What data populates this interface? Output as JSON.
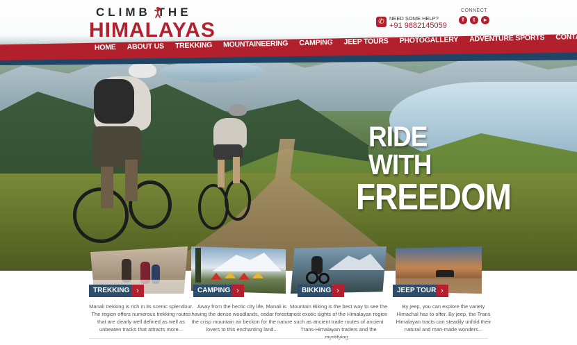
{
  "logo": {
    "line1": "CLIMB  THE",
    "line2": "HIMALAYAS"
  },
  "contact": {
    "help_label": "NEED SOME HELP?",
    "phone": "+91 9882145059",
    "connect_label": "CONNECT",
    "social": [
      {
        "icon": "facebook-icon",
        "glyph": "f"
      },
      {
        "icon": "twitter-icon",
        "glyph": "t"
      },
      {
        "icon": "youtube-icon",
        "glyph": "▸"
      }
    ]
  },
  "nav": {
    "items": [
      "HOME",
      "ABOUT US",
      "TREKKING",
      "MOUNTAINEERING",
      "CAMPING",
      "JEEP TOURS",
      "PHOTOGALLERY",
      "ADVENTURE SPORTS",
      "CONTACT"
    ]
  },
  "hero": {
    "line1": "RIDE WITH",
    "line2": "FREEDOM"
  },
  "cards": [
    {
      "tag": "TREKKING",
      "text": "Manali trekking is rich in its scenic splendour. The region offers numerous trekking routes that are clearly well defined as well as unbeaten tracks that attracts more..."
    },
    {
      "tag": "CAMPING",
      "text": "Away from the hectic city life, Manali is having the dense woodlands, cedar forests, the crisp mountain air beckon for the nature lovers to this enchanting land..."
    },
    {
      "tag": "BIKKING",
      "text": "Mountain Biking is the best way to see the most exotic sights of the Himalayan region such as ancient trade routes of ancient Trans-Himalayan traders and the mystifying..."
    },
    {
      "tag": "JEEP TOURS",
      "text": "By jeep, you can explore the variety Himachal has to offer. By jeep, the Trans Himalayan tracts can steadily unfold their natural and man-made wonders..."
    }
  ],
  "colors": {
    "brand_red": "#b5202e",
    "nav_blue": "#1e4466",
    "tag_blue": "#2c4d6b"
  }
}
